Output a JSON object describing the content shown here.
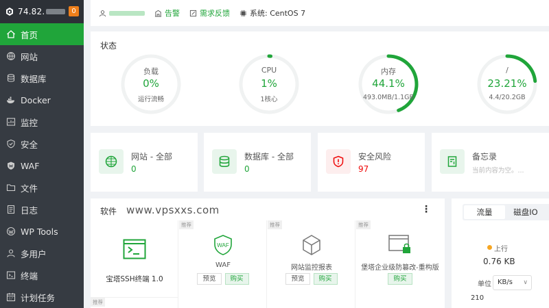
{
  "sidebar": {
    "ip": "74.82.",
    "badge": "0",
    "items": [
      {
        "label": "首页",
        "icon": "home-icon"
      },
      {
        "label": "网站",
        "icon": "globe-icon"
      },
      {
        "label": "数据库",
        "icon": "database-icon"
      },
      {
        "label": "Docker",
        "icon": "docker-icon"
      },
      {
        "label": "监控",
        "icon": "monitor-icon"
      },
      {
        "label": "安全",
        "icon": "shield-icon"
      },
      {
        "label": "WAF",
        "icon": "waf-shield-icon"
      },
      {
        "label": "文件",
        "icon": "folder-icon"
      },
      {
        "label": "日志",
        "icon": "log-icon"
      },
      {
        "label": "WP Tools",
        "icon": "wordpress-icon"
      },
      {
        "label": "多用户",
        "icon": "users-icon"
      },
      {
        "label": "终端",
        "icon": "terminal-icon"
      },
      {
        "label": "计划任务",
        "icon": "calendar-icon"
      }
    ]
  },
  "header": {
    "alert": "告警",
    "feedback": "需求反馈",
    "system": "系统:  CentOS 7"
  },
  "status": {
    "title": "状态",
    "gauges": [
      {
        "label": "负载",
        "value": "0%",
        "sub": "运行流畅",
        "percent": 0
      },
      {
        "label": "CPU",
        "value": "1%",
        "sub": "1核心",
        "percent": 1
      },
      {
        "label": "内存",
        "value": "44.1%",
        "sub": "493.0MB/1.1GB",
        "percent": 44.1
      },
      {
        "label": "/",
        "value": "23.21%",
        "sub": "4.4/20.2GB",
        "percent": 23.21
      }
    ],
    "color_ok": "#20a53a"
  },
  "overview": [
    {
      "title": "网站 - 全部",
      "value": "0"
    },
    {
      "title": "数据库 - 全部",
      "value": "0"
    },
    {
      "title": "安全风险",
      "value": "97"
    },
    {
      "title": "备忘录",
      "value": "当前内容为空。..."
    }
  ],
  "software": {
    "title": "软件",
    "watermark": "www.vpsxxs.com",
    "tag": "推荐",
    "preview": "预览",
    "buy": "购买",
    "items": [
      {
        "name": "宝塔SSH终端 1.0"
      },
      {
        "name": "WAF"
      },
      {
        "name": "网站监控报表"
      },
      {
        "name": "堡塔企业级防篡改-重构版"
      }
    ]
  },
  "traffic": {
    "tabs": [
      "流量",
      "磁盘IO"
    ],
    "up_label": "上行",
    "up_value": "0.76 KB",
    "unit_label": "单位",
    "unit_value": "KB/s",
    "axis_top": "210"
  }
}
